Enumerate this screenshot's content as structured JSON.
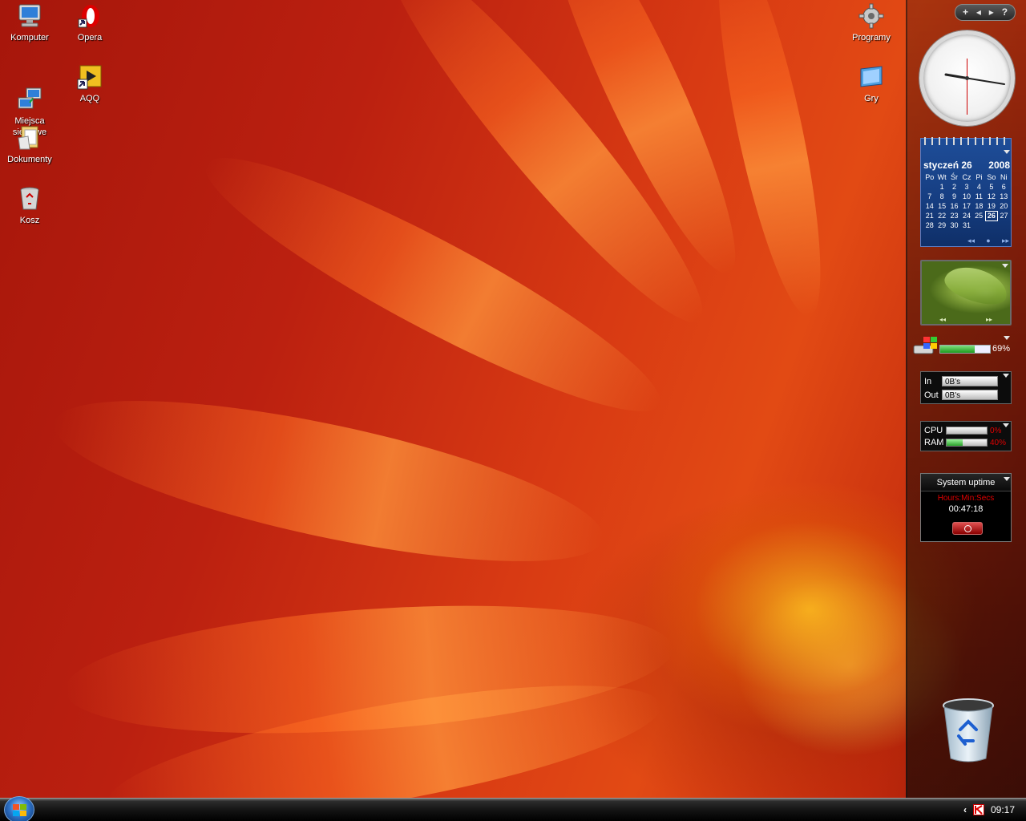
{
  "desktop": {
    "icons": [
      {
        "label": "Komputer"
      },
      {
        "label": "Opera"
      },
      {
        "label": "Miejsca\nsieciowe"
      },
      {
        "label": "AQQ"
      },
      {
        "label": "Dokumenty"
      },
      {
        "label": "Kosz"
      },
      {
        "label": "Programy"
      },
      {
        "label": "Gry"
      }
    ]
  },
  "sidebar": {
    "toolbar": {
      "add": "+",
      "prev": "◂",
      "next": "▸",
      "help": "?"
    },
    "calendar": {
      "month": "styczeń 26",
      "year": "2008",
      "weekdays": [
        "Po",
        "Wt",
        "Śr",
        "Cz",
        "Pi",
        "So",
        "Ni"
      ],
      "weeks": [
        [
          "",
          "1",
          "2",
          "3",
          "4",
          "5",
          "6"
        ],
        [
          "7",
          "8",
          "9",
          "10",
          "11",
          "12",
          "13"
        ],
        [
          "14",
          "15",
          "16",
          "17",
          "18",
          "19",
          "20"
        ],
        [
          "21",
          "22",
          "23",
          "24",
          "25",
          "26",
          "27"
        ],
        [
          "28",
          "29",
          "30",
          "31",
          "",
          "",
          ""
        ]
      ],
      "today": "26"
    },
    "disk": {
      "value": "69%",
      "fill": 0.69
    },
    "network": {
      "in_label": "In",
      "in_value": "0B's",
      "out_label": "Out",
      "out_value": "0B's"
    },
    "meters": {
      "cpu_label": "CPU",
      "cpu_value": "0%",
      "cpu_fill": 0.0,
      "ram_label": "RAM",
      "ram_value": "40%",
      "ram_fill": 0.4
    },
    "uptime": {
      "title": "System uptime",
      "units": "Hours:Min:Secs",
      "time": "00:47:18"
    }
  },
  "taskbar": {
    "clock": "09:17",
    "tray_expand": "‹"
  },
  "colors": {
    "wallpaper_red": "#b01e08",
    "calendar_blue": "#1e4d98",
    "meter_green": "#2aa22a",
    "alert_red": "#e00000"
  },
  "icons": {
    "computer": "computer-icon",
    "opera": "opera-icon",
    "network": "network-places-icon",
    "aqq": "aqq-shortcut-icon",
    "documents": "documents-icon",
    "trash": "recycle-bin-icon",
    "programs": "gear-icon",
    "games": "games-icon",
    "start": "windows-flag-icon"
  }
}
